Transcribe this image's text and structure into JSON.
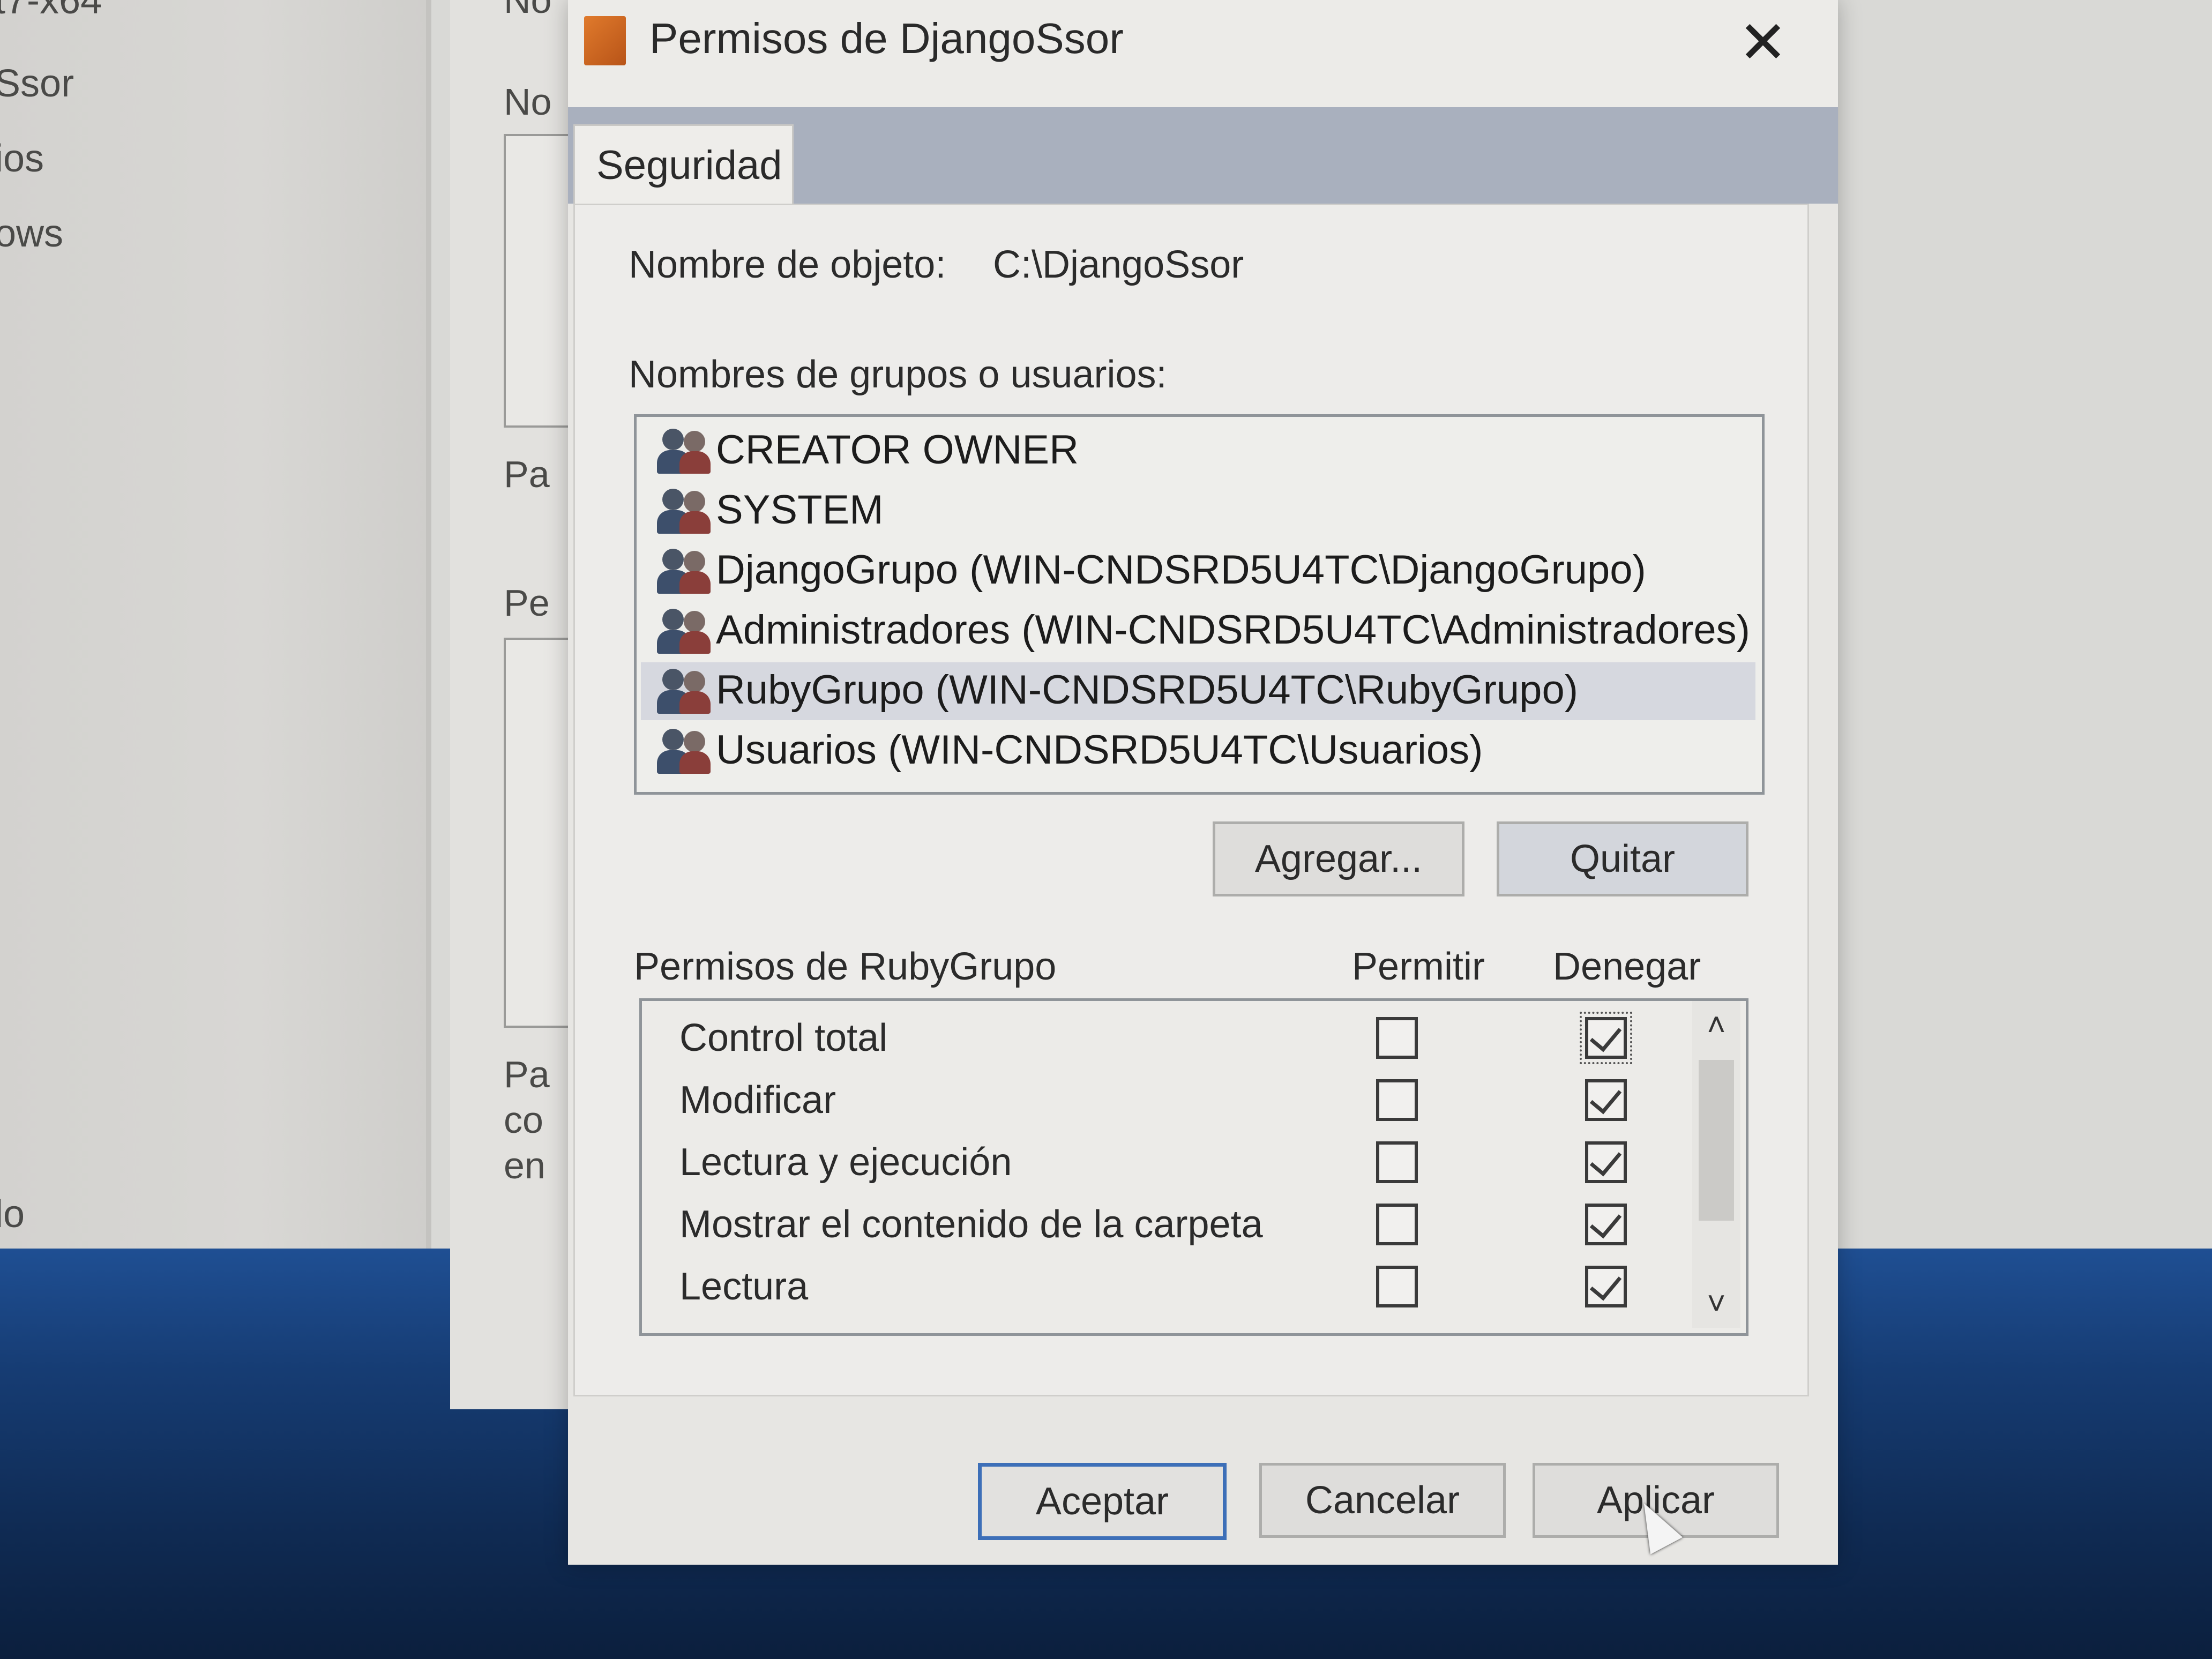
{
  "background": {
    "left_fragments": [
      "t7-x64",
      "Ssor",
      "ios",
      "ows",
      "lo"
    ],
    "window_fragments": [
      "No",
      "Pa",
      "Pe",
      "Pa",
      "co",
      "en"
    ]
  },
  "dialog": {
    "title": "Permisos de DjangoSsor",
    "close_glyph": "✕",
    "tab_label": "Seguridad",
    "object_name_label": "Nombre de objeto:",
    "object_name_value": "C:\\DjangoSsor",
    "groups_label": "Nombres de grupos o usuarios:",
    "users": [
      {
        "name": "CREATOR OWNER",
        "icon": "users-icon"
      },
      {
        "name": "SYSTEM",
        "icon": "users-icon"
      },
      {
        "name": "DjangoGrupo (WIN-CNDSRD5U4TC\\DjangoGrupo)",
        "icon": "users-icon"
      },
      {
        "name": "Administradores (WIN-CNDSRD5U4TC\\Administradores)",
        "icon": "users-icon"
      },
      {
        "name": "RubyGrupo (WIN-CNDSRD5U4TC\\RubyGrupo)",
        "icon": "users-icon",
        "selected": true
      },
      {
        "name": "Usuarios (WIN-CNDSRD5U4TC\\Usuarios)",
        "icon": "users-icon"
      }
    ],
    "add_button": "Agregar...",
    "remove_button": "Quitar",
    "permissions_label": "Permisos de RubyGrupo",
    "allow_header": "Permitir",
    "deny_header": "Denegar",
    "permissions": [
      {
        "name": "Control total",
        "allow": false,
        "deny": true
      },
      {
        "name": "Modificar",
        "allow": false,
        "deny": true
      },
      {
        "name": "Lectura y ejecución",
        "allow": false,
        "deny": true
      },
      {
        "name": "Mostrar el contenido de la carpeta",
        "allow": false,
        "deny": true
      },
      {
        "name": "Lectura",
        "allow": false,
        "deny": true
      }
    ],
    "scroll_up_glyph": "˄",
    "scroll_down_glyph": "˅",
    "ok_button": "Aceptar",
    "cancel_button": "Cancelar",
    "apply_button": "Aplicar"
  },
  "colors": {
    "taskbar": "#1f4f93",
    "tab_strip": "#a9b0be",
    "default_button_border": "#3d6fb8",
    "selected_row": "#d6d8df"
  }
}
